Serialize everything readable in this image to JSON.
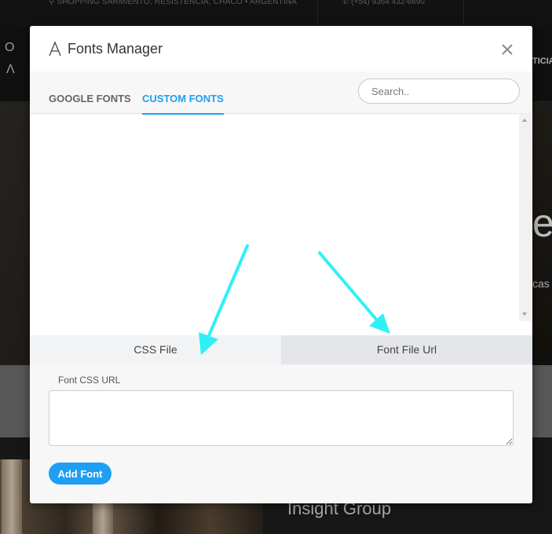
{
  "background": {
    "address": "SHOPPING SARMIENTO, RESISTENCIA, CHACO • ARGENTINA",
    "phone": "(+54) 9364 432-6690",
    "logo_top": "O",
    "logo_bottom": "Λ",
    "nav_partial": "TICIA",
    "hero_partial_heading": "e",
    "hero_partial_text": "cas",
    "section_heading": "Insight Group"
  },
  "modal": {
    "title": "Fonts Manager",
    "title_icon": "font-icon",
    "close_icon": "close-icon",
    "tabs": [
      {
        "label": "GOOGLE FONTS",
        "active": false
      },
      {
        "label": "CUSTOM FONTS",
        "active": true
      }
    ],
    "search": {
      "placeholder": "Search..",
      "value": ""
    },
    "subtabs": [
      {
        "label": "CSS File",
        "active": true
      },
      {
        "label": "Font File Url",
        "active": false
      }
    ],
    "field_label": "Font CSS URL",
    "field_value": "",
    "add_button_label": "Add Font"
  },
  "colors": {
    "accent": "#1e9ff2",
    "arrow": "#2ff0f7",
    "active_subtab": "#f2f3f5",
    "inactive_subtab": "#e4e6ea"
  }
}
